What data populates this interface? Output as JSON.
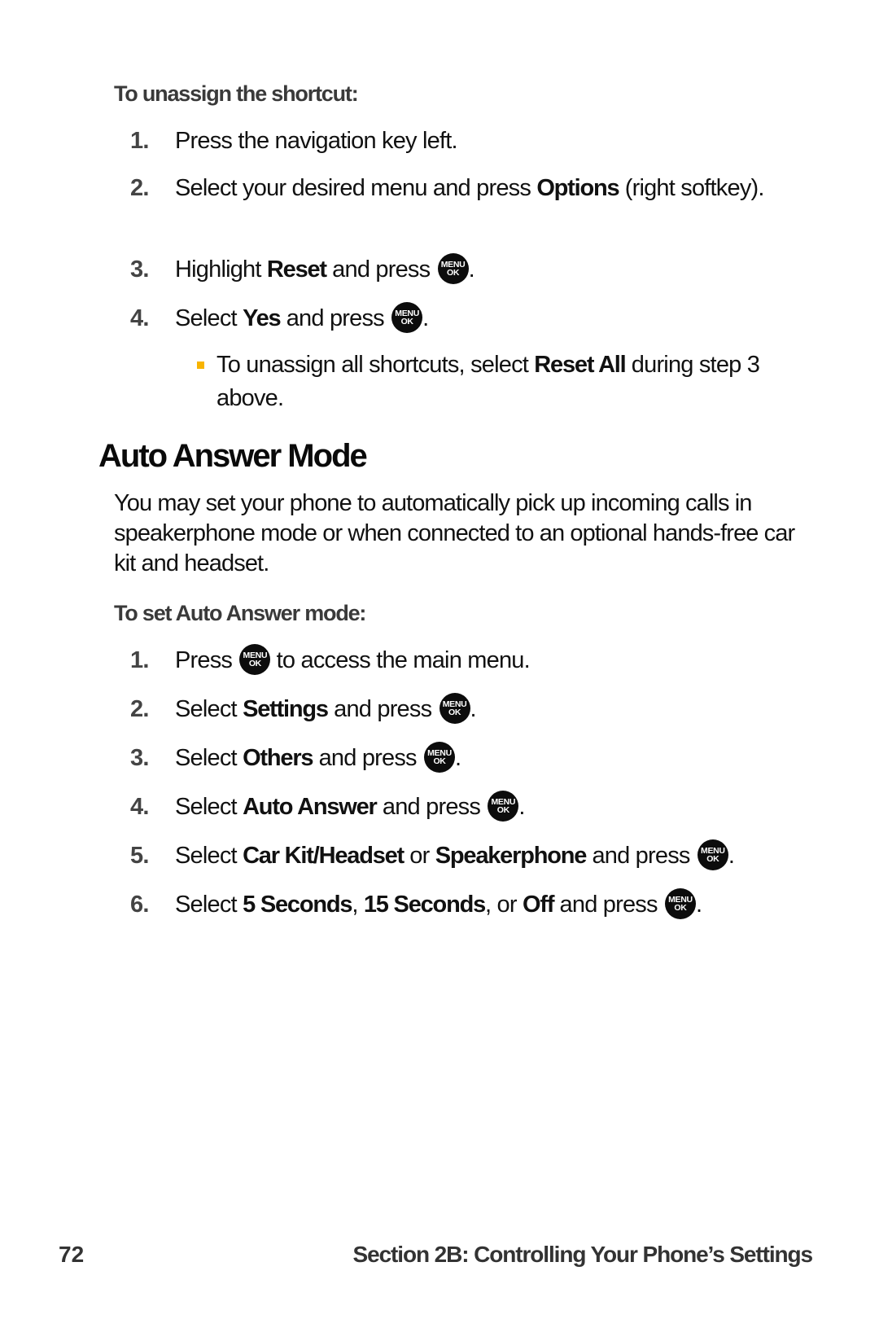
{
  "unassign": {
    "heading": "To unassign the shortcut:",
    "steps": [
      {
        "num": "1.",
        "parts": [
          "Press the navigation key left."
        ]
      },
      {
        "num": "2.",
        "pre": "Select your desired menu and press ",
        "bold": "Options",
        "post": " (right softkey)."
      },
      {
        "num": "3.",
        "pre": "Highlight ",
        "bold": "Reset",
        "post": " and press "
      },
      {
        "num": "4.",
        "pre": "Select ",
        "bold": "Yes",
        "post": " and press "
      }
    ],
    "note": {
      "pre": "To unassign all shortcuts, select ",
      "bold": "Reset All",
      "post": " during step 3 above."
    }
  },
  "section": {
    "title": "Auto Answer Mode",
    "intro": "You may set your phone to automatically pick up incoming calls in speakerphone mode or when connected to an optional hands-free car kit and headset."
  },
  "set_mode": {
    "heading": "To set Auto Answer mode:",
    "steps": [
      {
        "num": "1.",
        "pre": "Press ",
        "post": " to access the main menu."
      },
      {
        "num": "2.",
        "pre": "Select ",
        "bold": "Settings",
        "post": " and press "
      },
      {
        "num": "3.",
        "pre": "Select ",
        "bold": "Others",
        "post": " and press "
      },
      {
        "num": "4.",
        "pre": "Select ",
        "bold": "Auto Answer",
        "post": " and press "
      },
      {
        "num": "5.",
        "pre": "Select ",
        "bold": "Car Kit/Headset",
        "mid": " or ",
        "bold2": "Speakerphone",
        "post": " and press "
      },
      {
        "num": "6.",
        "pre": "Select ",
        "bold": "5 Seconds",
        "mid": ", ",
        "bold2": "15 Seconds",
        "mid2": ", or ",
        "bold3": "Off",
        "post": " and press "
      }
    ]
  },
  "key_icon": {
    "top": "MENU",
    "bottom": "OK"
  },
  "punct": {
    "period": "."
  },
  "footer": {
    "page_number": "72",
    "section_label": "Section 2B: Controlling Your Phone’s Settings"
  },
  "colors": {
    "bullet": "#f8b400"
  }
}
